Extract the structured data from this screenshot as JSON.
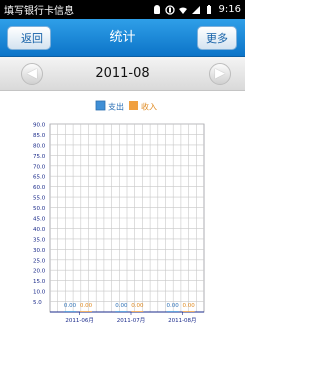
{
  "status_bar": {
    "notification": "填写银行卡信息",
    "time": "9:16",
    "icons": [
      "android-icon",
      "usb-icon",
      "wifi-icon",
      "signal-icon",
      "battery-icon"
    ]
  },
  "header": {
    "back_label": "返回",
    "title": "统计",
    "more_label": "更多"
  },
  "month_nav": {
    "month": "2011-08",
    "prev_icon": "arrow-left-icon",
    "next_icon": "arrow-right-icon"
  },
  "legend": [
    {
      "name": "支出",
      "color": "#3f8fd6"
    },
    {
      "name": "收入",
      "color": "#f0a040"
    }
  ],
  "chart_data": {
    "type": "bar",
    "categories": [
      "2011-06月",
      "2011-07月",
      "2011-08月"
    ],
    "series": [
      {
        "name": "支出",
        "values": [
          0,
          0,
          0
        ],
        "labels": [
          "0.00",
          "0.00",
          "0.00"
        ]
      },
      {
        "name": "收入",
        "values": [
          0,
          0,
          0
        ],
        "labels": [
          "0.00",
          "0.00",
          "0.00"
        ]
      }
    ],
    "ylim": [
      0,
      90
    ],
    "yticks": [
      "90.0",
      "85.0",
      "80.0",
      "75.0",
      "70.0",
      "65.0",
      "60.0",
      "55.0",
      "50.0",
      "45.0",
      "40.0",
      "35.0",
      "30.0",
      "25.0",
      "20.0",
      "15.0",
      "10.0",
      "5.0"
    ],
    "grid": true,
    "legend_position": "top-center"
  }
}
